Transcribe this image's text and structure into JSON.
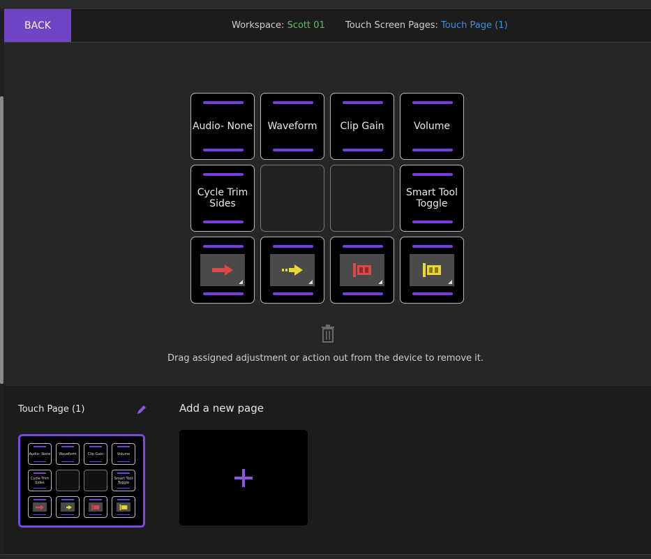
{
  "header": {
    "back_label": "BACK",
    "workspace_label": "Workspace:",
    "workspace_value": "Scott 01",
    "pages_label": "Touch Screen Pages:",
    "pages_value": "Touch Page (1)"
  },
  "keys": [
    {
      "label": "Audio- None"
    },
    {
      "label": "Waveform"
    },
    {
      "label": "Clip Gain"
    },
    {
      "label": "Volume"
    },
    {
      "label": "Cycle Trim Sides"
    },
    {
      "label": ""
    },
    {
      "label": ""
    },
    {
      "label": "Smart Tool Toggle"
    },
    {
      "icon": "red-arrow-icon"
    },
    {
      "icon": "yellow-arrow-icon"
    },
    {
      "icon": "red-clip-icon"
    },
    {
      "icon": "yellow-clip-icon"
    }
  ],
  "hint": "Drag assigned adjustment or action out from the device to remove it.",
  "sidebar": {
    "page_title": "Touch Page (1)",
    "preview_keys": [
      "Audio- None",
      "Waveform",
      "Clip Gain",
      "Volume",
      "Cycle Trim Sides",
      "",
      "",
      "Smart Tool Toggle"
    ]
  },
  "add_page": {
    "label": "Add a new page"
  },
  "colors": {
    "accent": "#6f45c6",
    "bar": "#7a3ee0",
    "workspace": "#5fbf5f",
    "page_link": "#3f8fe0"
  }
}
